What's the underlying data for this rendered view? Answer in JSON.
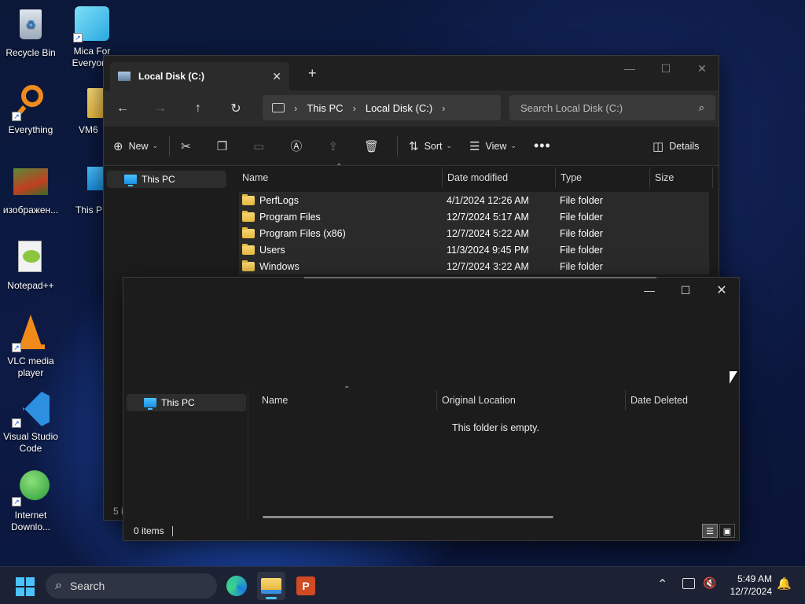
{
  "desktop": {
    "icons": [
      {
        "label": "Recycle Bin"
      },
      {
        "label": "Mica For Everyone"
      },
      {
        "label": "Everything"
      },
      {
        "label": "VM6"
      },
      {
        "label": "изображен..."
      },
      {
        "label": "This P"
      },
      {
        "label": "Notepad++"
      },
      {
        "label": "VLC media player"
      },
      {
        "label": "Visual Studio Code"
      },
      {
        "label": "Internet Downlo..."
      }
    ]
  },
  "explorer": {
    "tab_title": "Local Disk (C:)",
    "breadcrumb": [
      "This PC",
      "Local Disk (C:)"
    ],
    "search_placeholder": "Search Local Disk (C:)",
    "commands": {
      "new": "New",
      "sort": "Sort",
      "view": "View",
      "details": "Details"
    },
    "nav_item": "This PC",
    "columns": [
      "Name",
      "Date modified",
      "Type",
      "Size"
    ],
    "rows": [
      {
        "name": "PerfLogs",
        "date": "4/1/2024 12:26 AM",
        "type": "File folder"
      },
      {
        "name": "Program Files",
        "date": "12/7/2024 5:17 AM",
        "type": "File folder"
      },
      {
        "name": "Program Files (x86)",
        "date": "12/7/2024 5:22 AM",
        "type": "File folder"
      },
      {
        "name": "Users",
        "date": "11/3/2024 9:45 PM",
        "type": "File folder"
      },
      {
        "name": "Windows",
        "date": "12/7/2024 3:22 AM",
        "type": "File folder"
      }
    ],
    "status_partial": "5 i"
  },
  "recycle": {
    "nav_item": "This PC",
    "columns": [
      "Name",
      "Original Location",
      "Date Deleted"
    ],
    "empty_text": "This folder is empty.",
    "status": "0 items"
  },
  "taskbar": {
    "search_label": "Search",
    "time": "5:49 AM",
    "date": "12/7/2024"
  }
}
